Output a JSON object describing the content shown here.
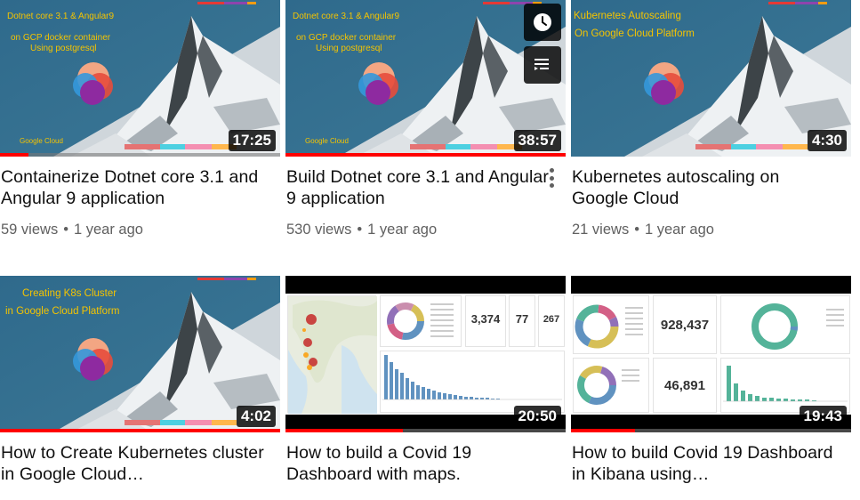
{
  "videos": [
    {
      "thumbnail": {
        "lines": [
          "Dotnet core 3.1 & Angular9",
          "on GCP docker container",
          "Using postgresql"
        ],
        "footer": "Google Cloud"
      },
      "duration": "17:25",
      "progress": 0.1,
      "title": "Containerize Dotnet core 3.1 and Angular 9 application",
      "views": "59 views",
      "age": "1 year ago"
    },
    {
      "thumbnail": {
        "lines": [
          "Dotnet core 3.1 & Angular9",
          "on GCP docker container",
          "Using postgresql"
        ],
        "footer": "Google Cloud"
      },
      "duration": "38:57",
      "progress": 1.0,
      "title": "Build Dotnet core 3.1 and Angular 9 application",
      "views": "530 views",
      "age": "1 year ago",
      "hover_icons": [
        "clock-icon",
        "add-to-queue-icon"
      ]
    },
    {
      "thumbnail": {
        "lines": [
          "Kubernetes Autoscaling",
          "On Google Cloud Platform"
        ]
      },
      "duration": "4:30",
      "title": "Kubernetes autoscaling on Google Cloud",
      "views": "21 views",
      "age": "1 year ago"
    },
    {
      "thumbnail": {
        "lines": [
          "Creating K8s Cluster",
          "in Google Cloud Platform"
        ]
      },
      "duration": "4:02",
      "progress": 1.0,
      "title": "How to Create Kubernetes cluster in Google Cloud…"
    },
    {
      "thumbnail": {
        "metrics": [
          "3,374",
          "77",
          "267"
        ]
      },
      "duration": "20:50",
      "progress": 0.42,
      "title": "How to build a Covid 19 Dashboard with maps."
    },
    {
      "thumbnail": {
        "metrics": [
          "928,437",
          "46,891"
        ]
      },
      "duration": "19:43",
      "progress": 0.23,
      "title": "How to build Covid 19 Dashboard in Kibana using…"
    }
  ],
  "colors": {
    "progress": "#ff0000",
    "thumb_text": "#f5c400",
    "thumb_bg": "#3c6a86"
  }
}
